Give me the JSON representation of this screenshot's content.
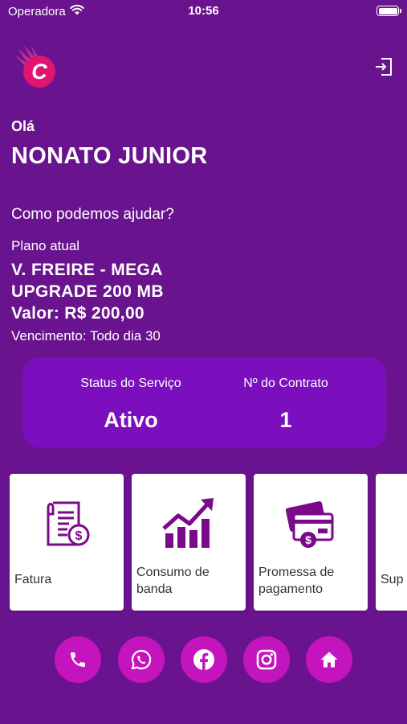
{
  "status_bar": {
    "carrier": "Operadora",
    "time": "10:56"
  },
  "header": {
    "logo_icon": "brand-logo-icon",
    "logout_icon": "logout-icon"
  },
  "greeting": {
    "hello": "Olá",
    "name": "NONATO JUNIOR",
    "help": "Como podemos ajudar?"
  },
  "plan": {
    "label": "Plano atual",
    "name": "V. FREIRE - MEGA UPGRADE 200 MB",
    "value": "Valor: R$ 200,00",
    "due": "Vencimento: Todo dia 30"
  },
  "service": {
    "status_label": "Status do Serviço",
    "status_value": "Ativo",
    "contract_label": "Nº do Contrato",
    "contract_value": "1"
  },
  "menu": [
    {
      "label": "Fatura",
      "icon": "invoice-icon"
    },
    {
      "label": "Consumo de banda",
      "icon": "chart-up-icon"
    },
    {
      "label": "Promessa de pagamento",
      "icon": "credit-card-icon"
    },
    {
      "label": "Sup",
      "icon": "support-icon"
    }
  ],
  "social": [
    "phone-icon",
    "whatsapp-icon",
    "facebook-icon",
    "instagram-icon",
    "home-icon"
  ],
  "colors": {
    "background": "#6a138e",
    "card": "#7b0fbd",
    "accent": "#c414bd",
    "icon": "#7a0a8a"
  }
}
